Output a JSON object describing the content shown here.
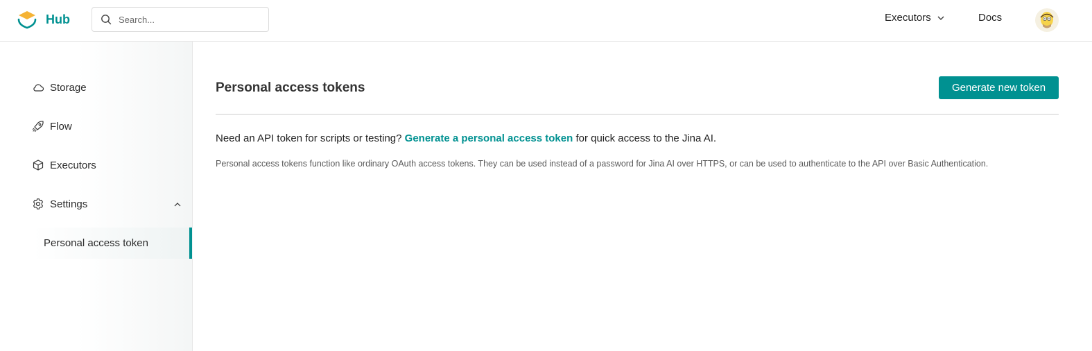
{
  "header": {
    "brand": "Hub",
    "search_placeholder": "Search...",
    "nav_executors": "Executors",
    "nav_docs": "Docs"
  },
  "sidebar": {
    "items": [
      {
        "label": "Storage",
        "icon": "cloud-icon"
      },
      {
        "label": "Flow",
        "icon": "rocket-icon"
      },
      {
        "label": "Executors",
        "icon": "cube-icon"
      },
      {
        "label": "Settings",
        "icon": "gear-icon"
      }
    ],
    "subitem": "Personal access token"
  },
  "main": {
    "title": "Personal access tokens",
    "generate_button": "Generate new token",
    "lead_prefix": "Need an API token for scripts or testing? ",
    "lead_link": "Generate a personal access token",
    "lead_suffix": " for quick access to the Jina AI.",
    "description": "Personal access tokens function like ordinary OAuth access tokens. They can be used instead of a password for Jina AI over HTTPS, or can be used to authenticate to the API over Basic Authentication."
  },
  "colors": {
    "accent": "#009191",
    "logo_yellow": "#f5b335"
  }
}
